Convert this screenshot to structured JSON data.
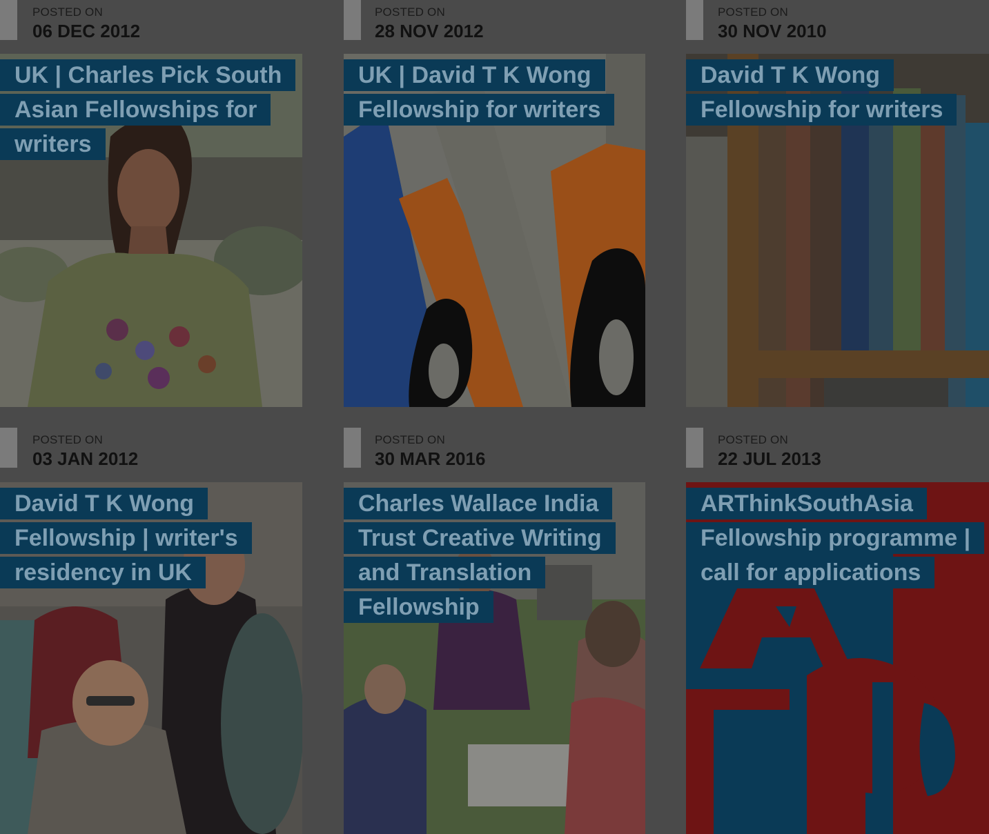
{
  "posts": [
    {
      "posted_label": "POSTED ON",
      "date": "06 DEC 2012",
      "title": "UK | Charles Pick South Asian Fellowships for writers",
      "image": "woman-portrait"
    },
    {
      "posted_label": "POSTED ON",
      "date": "28 NOV 2012",
      "title": "UK | David T K Wong Fellowship for writers",
      "image": "penguin-book-spines"
    },
    {
      "posted_label": "POSTED ON",
      "date": "30 NOV 2010",
      "title": "David T K Wong Fellowship for writers",
      "image": "bookshelf"
    },
    {
      "posted_label": "POSTED ON",
      "date": "03 JAN 2012",
      "title": "David T K Wong Fellowship | writer's residency in UK",
      "image": "group-photo"
    },
    {
      "posted_label": "POSTED ON",
      "date": "30 MAR 2016",
      "title": "Charles Wallace India Trust Creative Writing and Translation Fellowship",
      "image": "outdoor-workshop"
    },
    {
      "posted_label": "POSTED ON",
      "date": "22 JUL 2013",
      "title": "ARThinkSouthAsia Fellowship programme | call for applications",
      "image": "ats-logo"
    }
  ],
  "colors": {
    "overlay_bg": "#4a4a4a",
    "title_bg": "#0a3a56",
    "title_text": "#7f9fb3",
    "date_text": "#111111",
    "meta_bar": "#7b7b7b"
  }
}
